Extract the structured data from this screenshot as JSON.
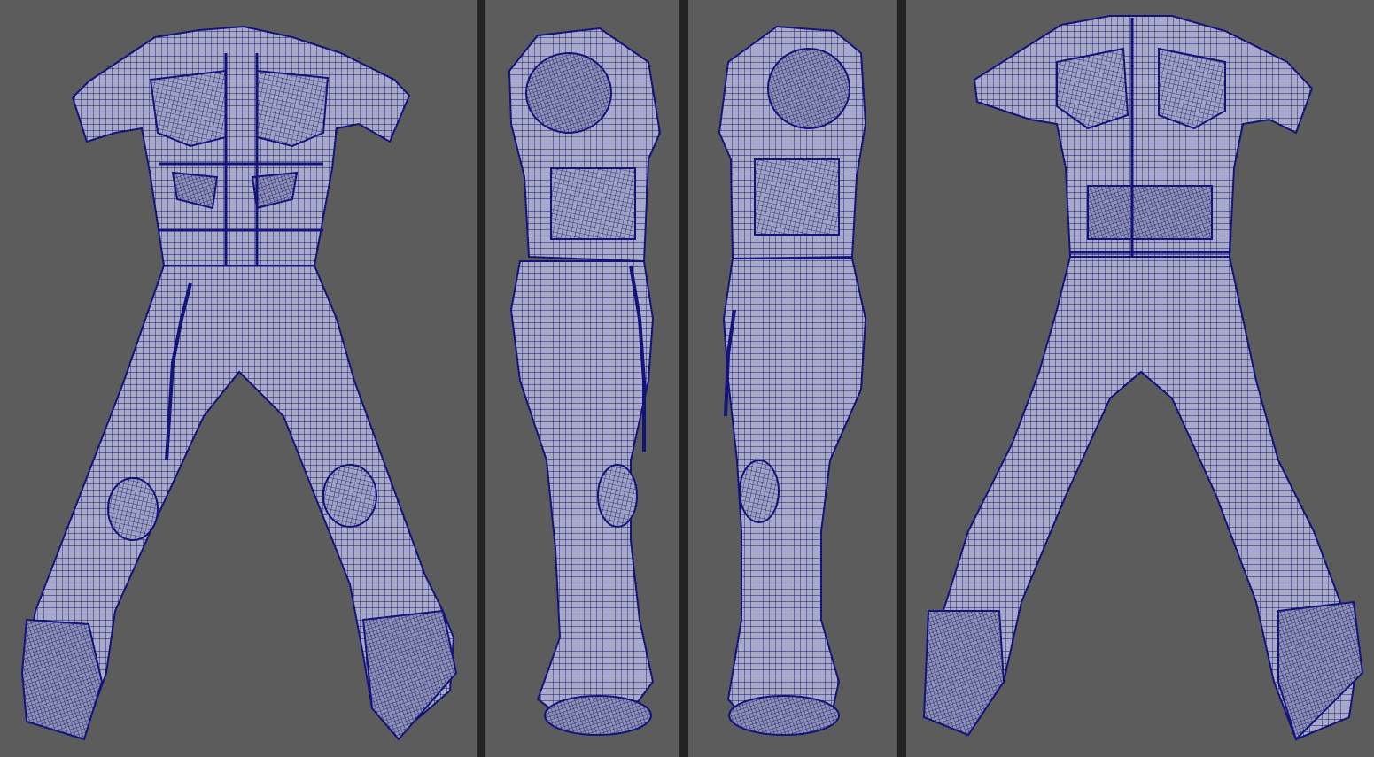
{
  "viewport": {
    "background_color": "#5c5c5c",
    "divider_color": "#232323",
    "mesh_fill_color": "#a9abc6",
    "wire_color": "#13137a",
    "panels": [
      {
        "view": "front"
      },
      {
        "view": "side-right"
      },
      {
        "view": "side-left"
      },
      {
        "view": "back"
      }
    ]
  }
}
